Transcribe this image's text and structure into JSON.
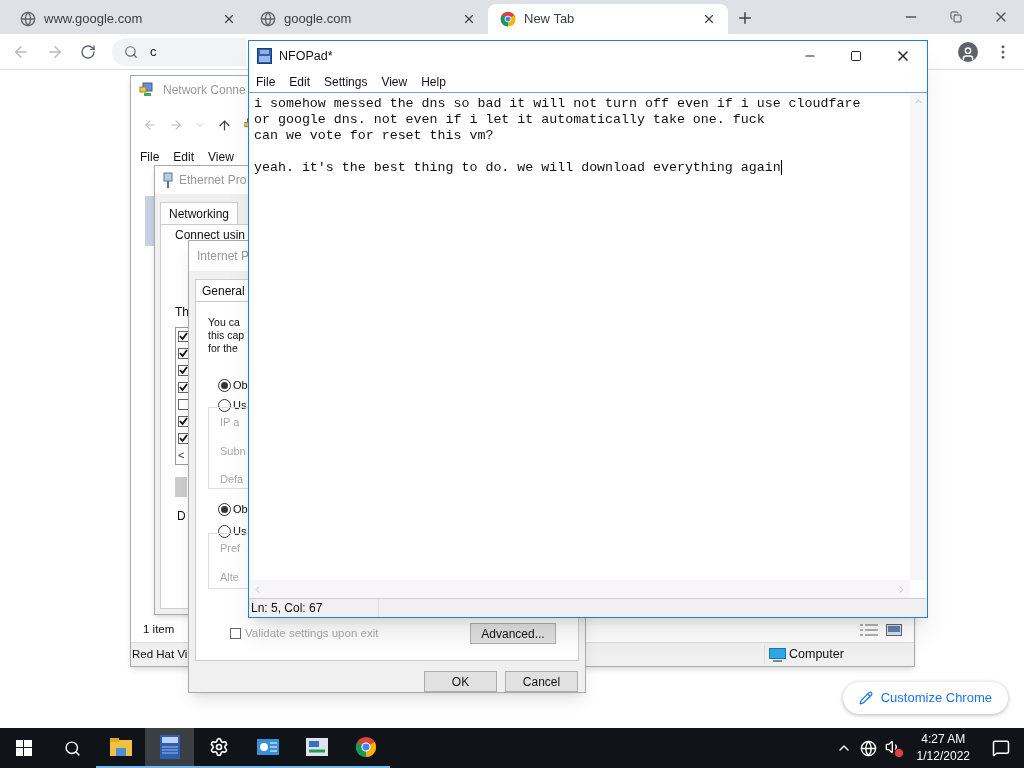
{
  "browser": {
    "tabs": [
      {
        "title": "www.google.com",
        "selected": false,
        "kind": "globe"
      },
      {
        "title": "google.com",
        "selected": false,
        "kind": "globe"
      },
      {
        "title": "New Tab",
        "selected": true,
        "kind": "chrome"
      }
    ],
    "address": "c",
    "customize_button": "Customize Chrome"
  },
  "network_window": {
    "title": "Network Conne",
    "menu": [
      "File",
      "Edit",
      "View"
    ],
    "item_count": "1 item",
    "status_left": "Red Hat Vi",
    "status_right": "Computer"
  },
  "ethernet_dialog": {
    "title": "Ethernet Pro",
    "tab": "Networking",
    "connect_label": "Connect usin",
    "list_label": "Th",
    "items": [
      {
        "checked": true
      },
      {
        "checked": true
      },
      {
        "checked": true
      },
      {
        "checked": true
      },
      {
        "checked": false
      },
      {
        "checked": true
      },
      {
        "checked": true
      }
    ],
    "scroll_arrow": "<",
    "group_label": "D"
  },
  "ip_dialog": {
    "title": "Internet P",
    "tab": "General",
    "intro": [
      "You ca",
      "this cap",
      "for the"
    ],
    "address_radios": [
      {
        "label": "Ob",
        "selected": true
      },
      {
        "label": "Us",
        "selected": false
      }
    ],
    "address_fields": [
      "IP a",
      "Subn",
      "Defa"
    ],
    "dns_radios": [
      {
        "label": "Ob",
        "selected": true
      },
      {
        "label": "Us",
        "selected": false
      }
    ],
    "dns_fields": [
      "Pref",
      "Alte"
    ],
    "validate": {
      "label": "Validate settings upon exit",
      "checked": false
    },
    "advanced_button": "Advanced...",
    "buttons": [
      "OK",
      "Cancel"
    ]
  },
  "nfopad": {
    "title": "NFOPad*",
    "menu": [
      "File",
      "Edit",
      "Settings",
      "View",
      "Help"
    ],
    "text": "i somehow messed the dns so bad it will not turn off even if i use cloudfare\nor google dns. not even if i let it automatically take one. fuck\ncan we vote for reset this vm?\n\nyeah. it's the best thing to do. we will download everything again",
    "status": "Ln: 5, Col: 67"
  },
  "taskbar": {
    "apps": [
      {
        "kind": "explorer",
        "selected": false
      },
      {
        "kind": "nfo",
        "selected": true
      },
      {
        "kind": "settings",
        "selected": false
      },
      {
        "kind": "network",
        "selected": false
      },
      {
        "kind": "control",
        "selected": false
      },
      {
        "kind": "chrome",
        "selected": false
      }
    ],
    "time": "4:27 AM",
    "date": "1/12/2022"
  }
}
